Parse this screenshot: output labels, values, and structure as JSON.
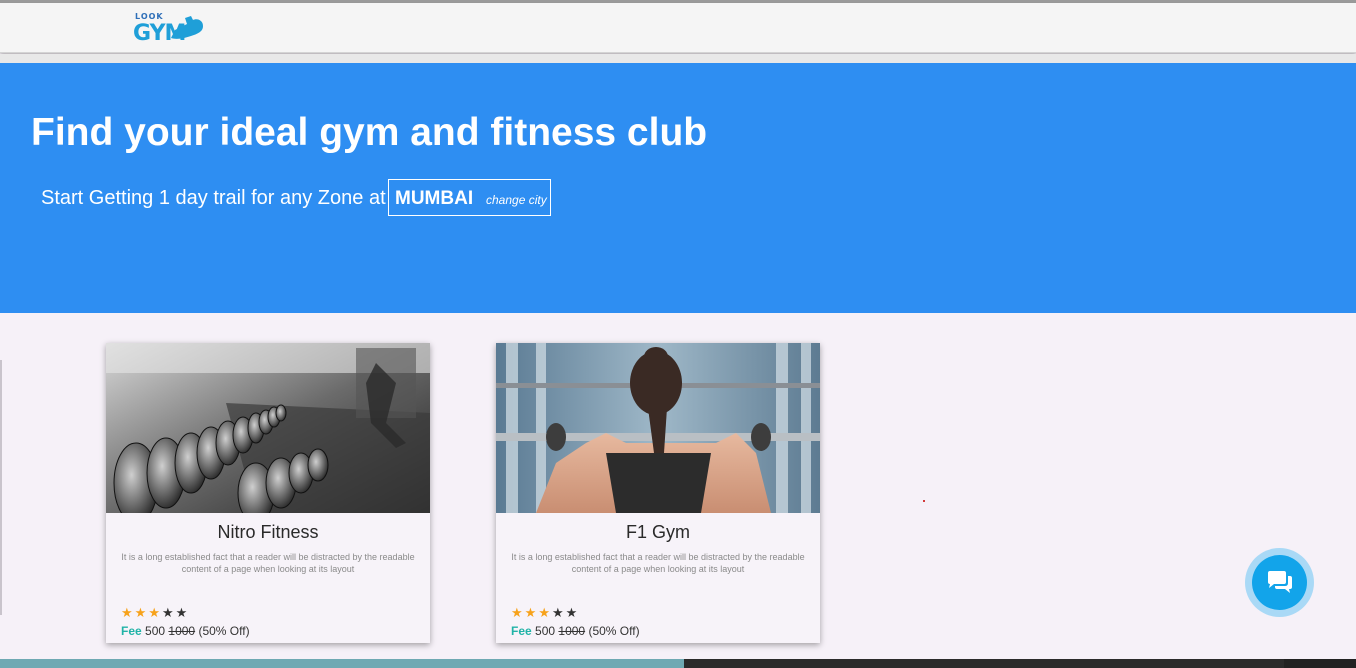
{
  "header": {
    "logo_top": "LOOK",
    "logo_main": "GYM"
  },
  "hero": {
    "title": "Find your ideal gym and fitness club",
    "subtitle": "Start Getting 1 day trail for any Zone at",
    "city": "MUMBAI",
    "change_city": "change city"
  },
  "cards": [
    {
      "name": "Nitro Fitness",
      "description": "It is a long established fact that a reader will be distracted by the readable content of a page when looking at its layout",
      "rating": 3,
      "max_rating": 5,
      "fee_label": "Fee",
      "fee_price": "500",
      "fee_old": "1000",
      "fee_discount": "(50% Off)"
    },
    {
      "name": "F1 Gym",
      "description": "It is a long established fact that a reader will be distracted by the readable content of a page when looking at its layout",
      "rating": 3,
      "max_rating": 5,
      "fee_label": "Fee",
      "fee_price": "500",
      "fee_old": "1000",
      "fee_discount": "(50% Off)"
    }
  ],
  "chat": {
    "icon": "chat-bubbles-icon"
  },
  "colors": {
    "hero_bg": "#2e8ef2",
    "accent_fee": "#21b3a7",
    "star_on": "#f7a21b",
    "chat_button": "#12a4ea"
  }
}
